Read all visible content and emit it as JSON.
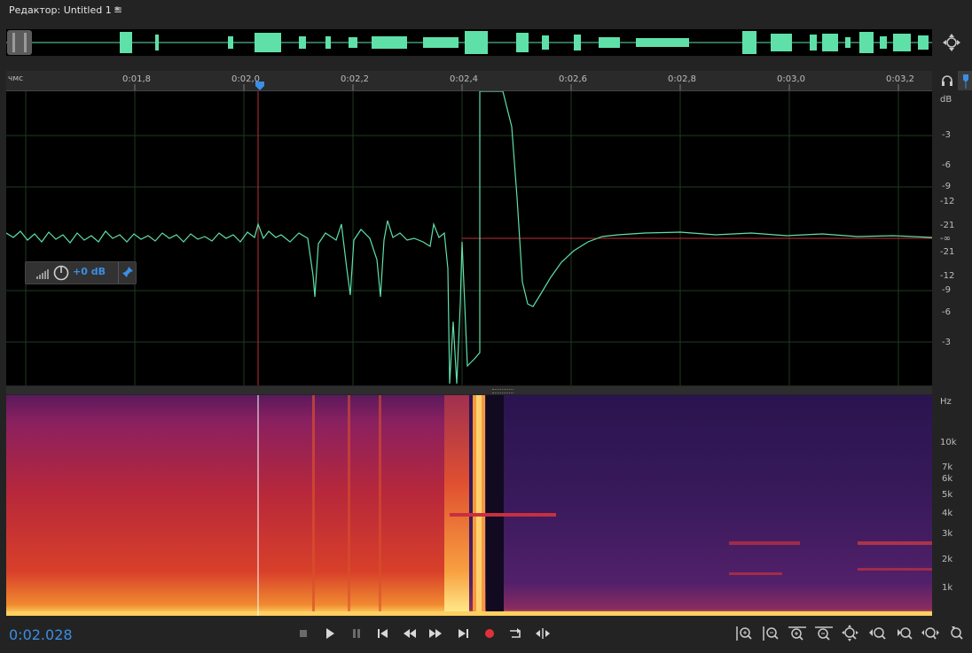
{
  "editor": {
    "title": "Редактор: Untitled 1 *"
  },
  "ruler": {
    "unit_label": "чмс",
    "ticks": [
      "0:01,8",
      "0:02,0",
      "0:02,2",
      "0:02,4",
      "0:02,6",
      "0:02,8",
      "0:03,0",
      "0:03,2"
    ]
  },
  "db_scale": {
    "unit": "dB",
    "labels_upper": [
      "-3",
      "-6",
      "-9",
      "-12",
      "-21"
    ],
    "center": "-∞",
    "labels_lower": [
      "-21",
      "-12",
      "-9",
      "-6",
      "-3"
    ]
  },
  "hud": {
    "gain_label": "+0 dB"
  },
  "hz_scale": {
    "unit": "Hz",
    "labels": [
      "10k",
      "7k",
      "6k",
      "5k",
      "4k",
      "3k",
      "2k",
      "1k"
    ]
  },
  "transport": {
    "current_time": "0:02.028",
    "buttons": [
      "stop-icon",
      "play-icon",
      "pause-icon",
      "skip-back-icon",
      "rewind-icon",
      "fast-forward-icon",
      "skip-forward-icon",
      "record-icon",
      "loop-icon",
      "skip-selection-icon"
    ]
  },
  "zoom_tools": [
    "zoom-in-amplitude-icon",
    "zoom-out-amplitude-icon",
    "zoom-in-time-icon",
    "zoom-out-time-icon",
    "zoom-out-full-icon",
    "zoom-in-start-icon",
    "zoom-in-end-icon",
    "zoom-selection-icon",
    "zoom-reset-icon"
  ],
  "colors": {
    "waveform": "#5fe0a8",
    "playhead": "#e04646",
    "time_display": "#3b8ee6",
    "record": "#e0303a"
  }
}
